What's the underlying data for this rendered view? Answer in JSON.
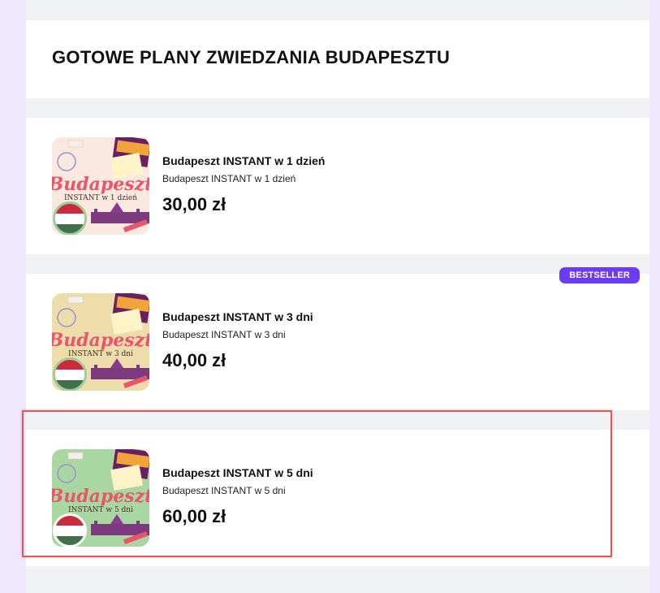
{
  "section": {
    "title": "GOTOWE PLANY ZWIEDZANIA BUDAPESZTU"
  },
  "products": [
    {
      "title": "Budapeszt INSTANT w 1 dzień",
      "subtitle": "Budapeszt INSTANT w 1 dzień",
      "price": "30,00 zł",
      "thumb": {
        "heading": "Budapeszt",
        "caption": "INSTANT w 1 dzień",
        "bg": "#fbe8de",
        "icon": "hungary-flag-icon"
      },
      "badge": ""
    },
    {
      "title": "Budapeszt INSTANT w 3 dni",
      "subtitle": "Budapeszt INSTANT w 3 dni",
      "price": "40,00 zł",
      "thumb": {
        "heading": "Budapeszt",
        "caption": "INSTANT w 3 dni",
        "bg": "#eedcaa",
        "icon": "hungary-flag-icon"
      },
      "badge": "BESTSELLER"
    },
    {
      "title": "Budapeszt INSTANT w 5 dni",
      "subtitle": "Budapeszt INSTANT w 5 dni",
      "price": "60,00 zł",
      "thumb": {
        "heading": "Budapeszt",
        "caption": "INSTANT w 5 dni",
        "bg": "#a9d7a1",
        "icon": "hungary-flag-icon"
      },
      "badge": ""
    }
  ],
  "colors": {
    "page_bg": "#efe7fb",
    "column_bg": "#f1f2f4",
    "badge": "#6c3bf5",
    "highlight": "#e05555",
    "flag_red": "#cd2a3e",
    "flag_green": "#436f4d",
    "thumb_text": "#e8566b"
  }
}
